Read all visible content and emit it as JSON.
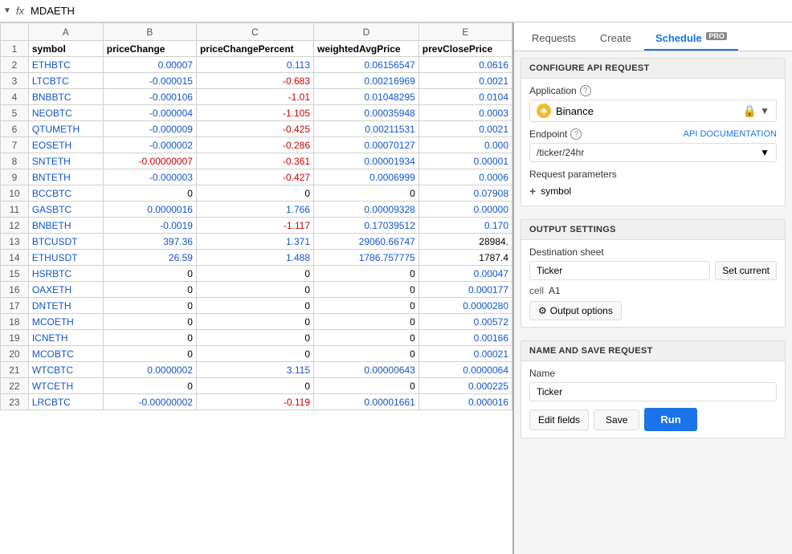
{
  "formulaBar": {
    "dropdownLabel": "▼",
    "fxLabel": "fx",
    "value": "MDAETH"
  },
  "tabs": {
    "requests": "Requests",
    "create": "Create",
    "schedule": "Schedule",
    "proLabel": "PRO"
  },
  "configureSection": {
    "title": "CONFIGURE API REQUEST",
    "applicationLabel": "Application",
    "applicationName": "Binance",
    "endpointLabel": "Endpoint",
    "apiDocLabel": "API DOCUMENTATION",
    "endpointValue": "/ticker/24hr",
    "requestParamsLabel": "Request parameters",
    "paramSymbol": "symbol"
  },
  "outputSection": {
    "title": "OUTPUT SETTINGS",
    "destinationSheetLabel": "Destination sheet",
    "destinationSheetValue": "Ticker",
    "setCurrentLabel": "Set current",
    "cellLabel": "cell",
    "cellValue": "A1",
    "outputOptionsLabel": "Output options"
  },
  "saveSection": {
    "title": "NAME AND SAVE REQUEST",
    "nameLabel": "Name",
    "nameValue": "Ticker",
    "editFieldsLabel": "Edit fields",
    "saveLabel": "Save",
    "runLabel": "Run"
  },
  "spreadsheet": {
    "columnHeaders": [
      "A",
      "B",
      "C",
      "D",
      "E"
    ],
    "headers": [
      "symbol",
      "priceChange",
      "priceChangePercent",
      "weightedAvgPrice",
      "prevClosePrice"
    ],
    "rows": [
      {
        "rowNum": "2",
        "a": "ETHBTC",
        "b": "0.00007",
        "c": "0.113",
        "d": "0.06156547",
        "e": "0.0616",
        "bColor": "blue",
        "cColor": "blue",
        "dColor": "blue",
        "eColor": "blue"
      },
      {
        "rowNum": "3",
        "a": "LTCBTC",
        "b": "-0.000015",
        "c": "-0.683",
        "d": "0.00216969",
        "e": "0.0021",
        "bColor": "blue",
        "cColor": "red",
        "dColor": "blue",
        "eColor": "blue"
      },
      {
        "rowNum": "4",
        "a": "BNBBTC",
        "b": "-0.000106",
        "c": "-1.01",
        "d": "0.01048295",
        "e": "0.0104",
        "bColor": "blue",
        "cColor": "red",
        "dColor": "blue",
        "eColor": "blue"
      },
      {
        "rowNum": "5",
        "a": "NEOBTC",
        "b": "-0.000004",
        "c": "-1.105",
        "d": "0.00035948",
        "e": "0.0003",
        "bColor": "blue",
        "cColor": "red",
        "dColor": "blue",
        "eColor": "blue"
      },
      {
        "rowNum": "6",
        "a": "QTUMETH",
        "b": "-0.000009",
        "c": "-0.425",
        "d": "0.00211531",
        "e": "0.0021",
        "bColor": "blue",
        "cColor": "red",
        "dColor": "blue",
        "eColor": "blue"
      },
      {
        "rowNum": "7",
        "a": "EOSETH",
        "b": "-0.000002",
        "c": "-0.286",
        "d": "0.00070127",
        "e": "0.000",
        "bColor": "blue",
        "cColor": "red",
        "dColor": "blue",
        "eColor": "blue"
      },
      {
        "rowNum": "8",
        "a": "SNTETH",
        "b": "-0.00000007",
        "c": "-0.361",
        "d": "0.00001934",
        "e": "0.00001",
        "bColor": "red",
        "cColor": "red",
        "dColor": "blue",
        "eColor": "blue"
      },
      {
        "rowNum": "9",
        "a": "BNTETH",
        "b": "-0.000003",
        "c": "-0.427",
        "d": "0.0006999",
        "e": "0.0006",
        "bColor": "blue",
        "cColor": "red",
        "dColor": "blue",
        "eColor": "blue"
      },
      {
        "rowNum": "10",
        "a": "BCCBTC",
        "b": "0",
        "c": "0",
        "d": "0",
        "e": "0.07908",
        "bColor": "black",
        "cColor": "black",
        "dColor": "black",
        "eColor": "blue"
      },
      {
        "rowNum": "11",
        "a": "GASBTC",
        "b": "0.0000016",
        "c": "1.766",
        "d": "0.00009328",
        "e": "0.00000",
        "bColor": "blue",
        "cColor": "blue",
        "dColor": "blue",
        "eColor": "blue"
      },
      {
        "rowNum": "12",
        "a": "BNBETH",
        "b": "-0.0019",
        "c": "-1.117",
        "d": "0.17039512",
        "e": "0.170",
        "bColor": "blue",
        "cColor": "red",
        "dColor": "blue",
        "eColor": "blue"
      },
      {
        "rowNum": "13",
        "a": "BTCUSDT",
        "b": "397.36",
        "c": "1.371",
        "d": "29060.66747",
        "e": "28984.",
        "bColor": "blue",
        "cColor": "blue",
        "dColor": "blue",
        "eColor": "black"
      },
      {
        "rowNum": "14",
        "a": "ETHUSDT",
        "b": "26.59",
        "c": "1.488",
        "d": "1786.757775",
        "e": "1787.4",
        "bColor": "blue",
        "cColor": "blue",
        "dColor": "blue",
        "eColor": "black"
      },
      {
        "rowNum": "15",
        "a": "HSRBTC",
        "b": "0",
        "c": "0",
        "d": "0",
        "e": "0.00047",
        "bColor": "black",
        "cColor": "black",
        "dColor": "black",
        "eColor": "blue"
      },
      {
        "rowNum": "16",
        "a": "OAXETH",
        "b": "0",
        "c": "0",
        "d": "0",
        "e": "0.000177",
        "bColor": "black",
        "cColor": "black",
        "dColor": "black",
        "eColor": "blue"
      },
      {
        "rowNum": "17",
        "a": "DNTETH",
        "b": "0",
        "c": "0",
        "d": "0",
        "e": "0.0000280",
        "bColor": "black",
        "cColor": "black",
        "dColor": "black",
        "eColor": "blue"
      },
      {
        "rowNum": "18",
        "a": "MCOETH",
        "b": "0",
        "c": "0",
        "d": "0",
        "e": "0.00572",
        "bColor": "black",
        "cColor": "black",
        "dColor": "black",
        "eColor": "blue"
      },
      {
        "rowNum": "19",
        "a": "ICNETH",
        "b": "0",
        "c": "0",
        "d": "0",
        "e": "0.00166",
        "bColor": "black",
        "cColor": "black",
        "dColor": "black",
        "eColor": "blue"
      },
      {
        "rowNum": "20",
        "a": "MCOBTC",
        "b": "0",
        "c": "0",
        "d": "0",
        "e": "0.00021",
        "bColor": "black",
        "cColor": "black",
        "dColor": "black",
        "eColor": "blue"
      },
      {
        "rowNum": "21",
        "a": "WTCBTC",
        "b": "0.0000002",
        "c": "3.115",
        "d": "0.00000643",
        "e": "0.0000064",
        "bColor": "blue",
        "cColor": "blue",
        "dColor": "blue",
        "eColor": "blue"
      },
      {
        "rowNum": "22",
        "a": "WTCETH",
        "b": "0",
        "c": "0",
        "d": "0",
        "e": "0.000225",
        "bColor": "black",
        "cColor": "black",
        "dColor": "black",
        "eColor": "blue"
      },
      {
        "rowNum": "23",
        "a": "LRCBTC",
        "b": "-0.00000002",
        "c": "-0.119",
        "d": "0.00001661",
        "e": "0.000016",
        "bColor": "blue",
        "cColor": "red",
        "dColor": "blue",
        "eColor": "blue"
      }
    ]
  }
}
